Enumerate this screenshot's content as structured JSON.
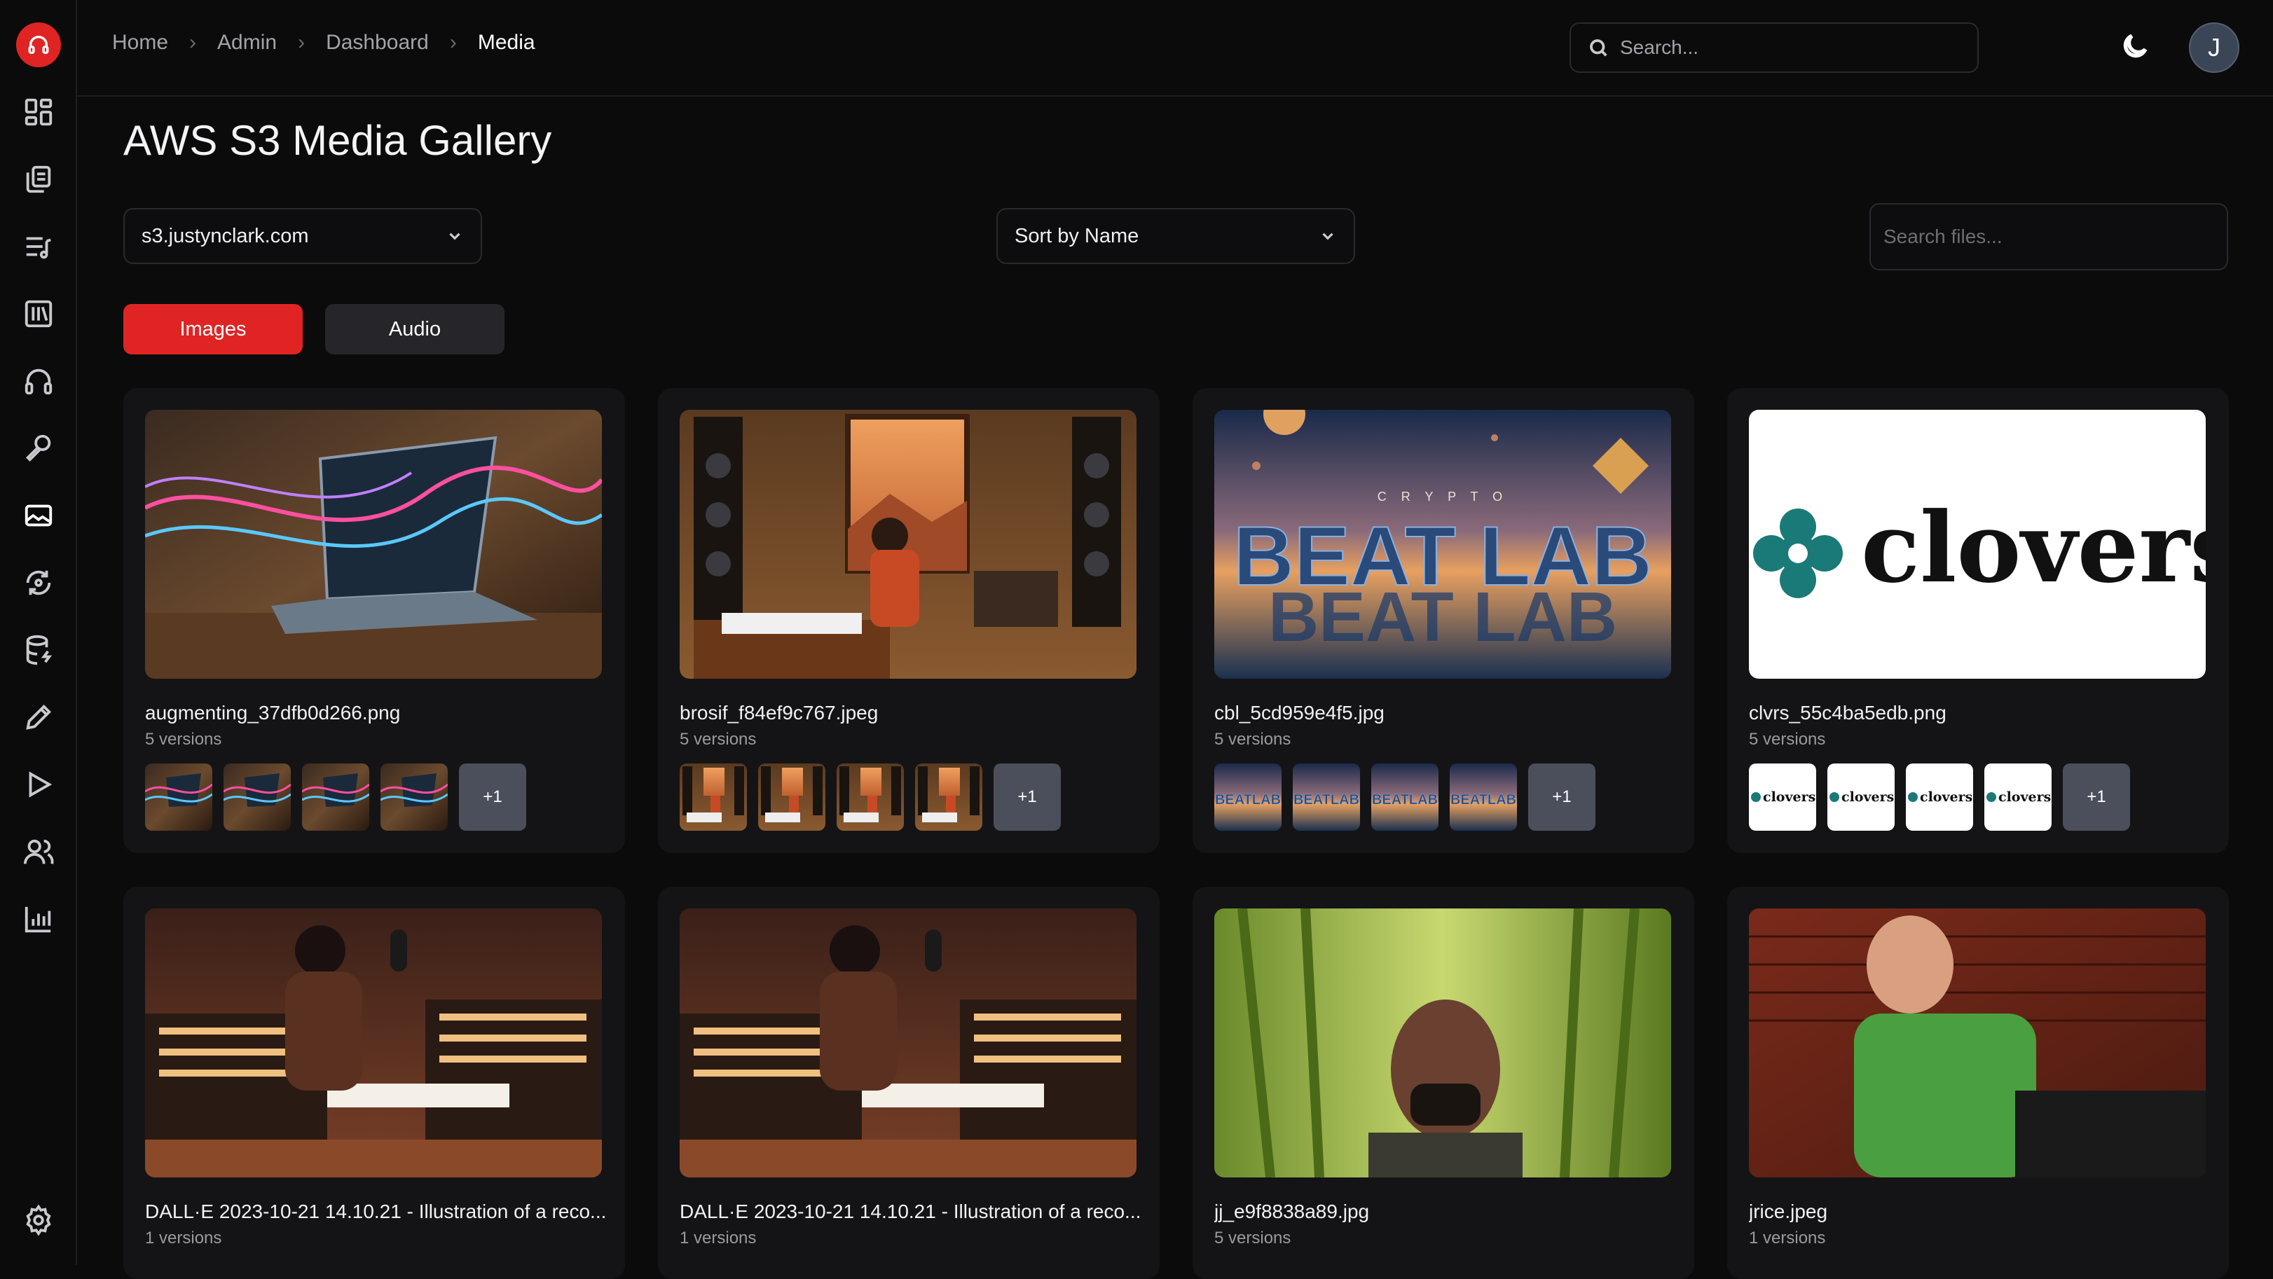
{
  "breadcrumb": [
    "Home",
    "Admin",
    "Dashboard",
    "Media"
  ],
  "header": {
    "search_placeholder": "Search...",
    "avatar_initial": "J"
  },
  "page": {
    "title": "AWS S3 Media Gallery"
  },
  "filters": {
    "bucket": "s3.justynclark.com",
    "sort": "Sort by Name",
    "file_search_placeholder": "Search files..."
  },
  "tabs": [
    {
      "label": "Images",
      "active": true
    },
    {
      "label": "Audio",
      "active": false
    }
  ],
  "sidebar": {
    "icons": [
      "dashboard-icon",
      "documents-icon",
      "playlist-icon",
      "library-icon",
      "headphones-icon",
      "microphone-icon",
      "image-icon",
      "refresh-icon",
      "database-icon",
      "pencil-icon",
      "play-icon",
      "users-icon",
      "chart-icon",
      "settings-icon"
    ]
  },
  "colors": {
    "accent": "#e02424",
    "background": "#0b0b0c",
    "card": "#141416"
  },
  "files": [
    {
      "name": "augmenting_37dfb0d266.png",
      "versions": "5 versions",
      "more": "+1",
      "thumb": "laptop"
    },
    {
      "name": "brosif_f84ef9c767.jpeg",
      "versions": "5 versions",
      "more": "+1",
      "thumb": "studio"
    },
    {
      "name": "cbl_5cd959e4f5.jpg",
      "versions": "5 versions",
      "more": "+1",
      "thumb": "beatlab",
      "logo_top": "C R Y P T O",
      "logo_main": "BEAT LAB"
    },
    {
      "name": "clvrs_55c4ba5edb.png",
      "versions": "5 versions",
      "more": "+1",
      "thumb": "clovers",
      "logo_text": "clovers"
    },
    {
      "name": "DALL·E 2023-10-21 14.10.21 - Illustration of a reco...",
      "versions": "1 versions",
      "thumb": "mixer"
    },
    {
      "name": "DALL·E 2023-10-21 14.10.21 - Illustration of a reco...",
      "versions": "1 versions",
      "thumb": "mixer"
    },
    {
      "name": "jj_e9f8838a89.jpg",
      "versions": "5 versions",
      "thumb": "bamboo"
    },
    {
      "name": "jrice.jpeg",
      "versions": "1 versions",
      "thumb": "brick"
    }
  ]
}
